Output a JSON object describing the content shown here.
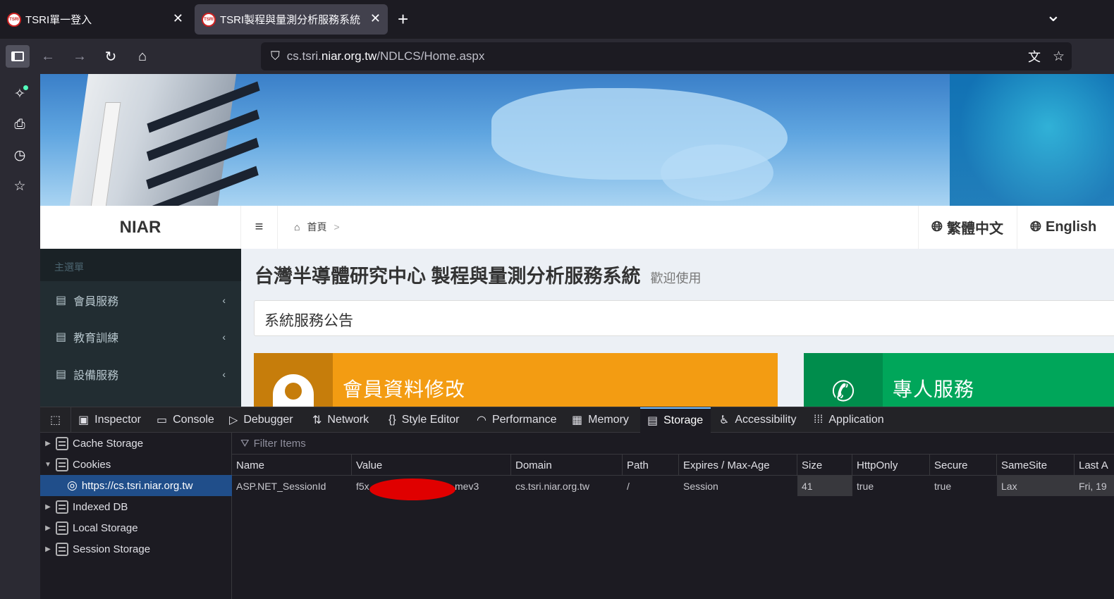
{
  "browser": {
    "tabs": [
      {
        "title": "TSRI單一登入",
        "favicon": "TSRI"
      },
      {
        "title": "TSRI製程與量測分析服務系統",
        "favicon": "TSRI"
      }
    ],
    "new_tab": "+",
    "list_all_tabs": "⌄",
    "url_host": "cs.tsri.",
    "url_domain": "niar.org.tw",
    "url_path": "/NDLCS/Home.aspx"
  },
  "site": {
    "logo": "NIAR",
    "breadcrumb_home": "首頁",
    "breadcrumb_sep": ">",
    "lang_zh": "繁體中文",
    "lang_en": "English",
    "menu_header": "主選單",
    "menu_items": [
      "會員服務",
      "教育訓練",
      "設備服務"
    ],
    "title": "台灣半導體研究中心 製程與量測分析服務系統",
    "subtitle": "歡迎使用",
    "notice": "系統服務公告",
    "cards": [
      {
        "label": "會員資料修改",
        "color": "#f39c12",
        "icon_color": "#c67d0b",
        "icon": "user-icon"
      },
      {
        "label": "專人服務",
        "color": "#00a65a",
        "icon_color": "#008d4c",
        "icon": "phone-icon"
      }
    ]
  },
  "devtools": {
    "tabs": [
      "Inspector",
      "Console",
      "Debugger",
      "Network",
      "Style Editor",
      "Performance",
      "Memory",
      "Storage",
      "Accessibility",
      "Application"
    ],
    "active_tab": "Storage",
    "tree": [
      "Cache Storage",
      "Cookies",
      "https://cs.tsri.niar.org.tw",
      "Indexed DB",
      "Local Storage",
      "Session Storage"
    ],
    "filter_placeholder": "Filter Items",
    "columns": [
      "Name",
      "Value",
      "Domain",
      "Path",
      "Expires / Max-Age",
      "Size",
      "HttpOnly",
      "Secure",
      "SameSite",
      "Last A"
    ],
    "row": [
      "ASP.NET_SessionId",
      "f5x",
      "mev3",
      "cs.tsri.niar.org.tw",
      "/",
      "Session",
      "41",
      "true",
      "true",
      "Lax",
      "Fri, 19"
    ]
  }
}
